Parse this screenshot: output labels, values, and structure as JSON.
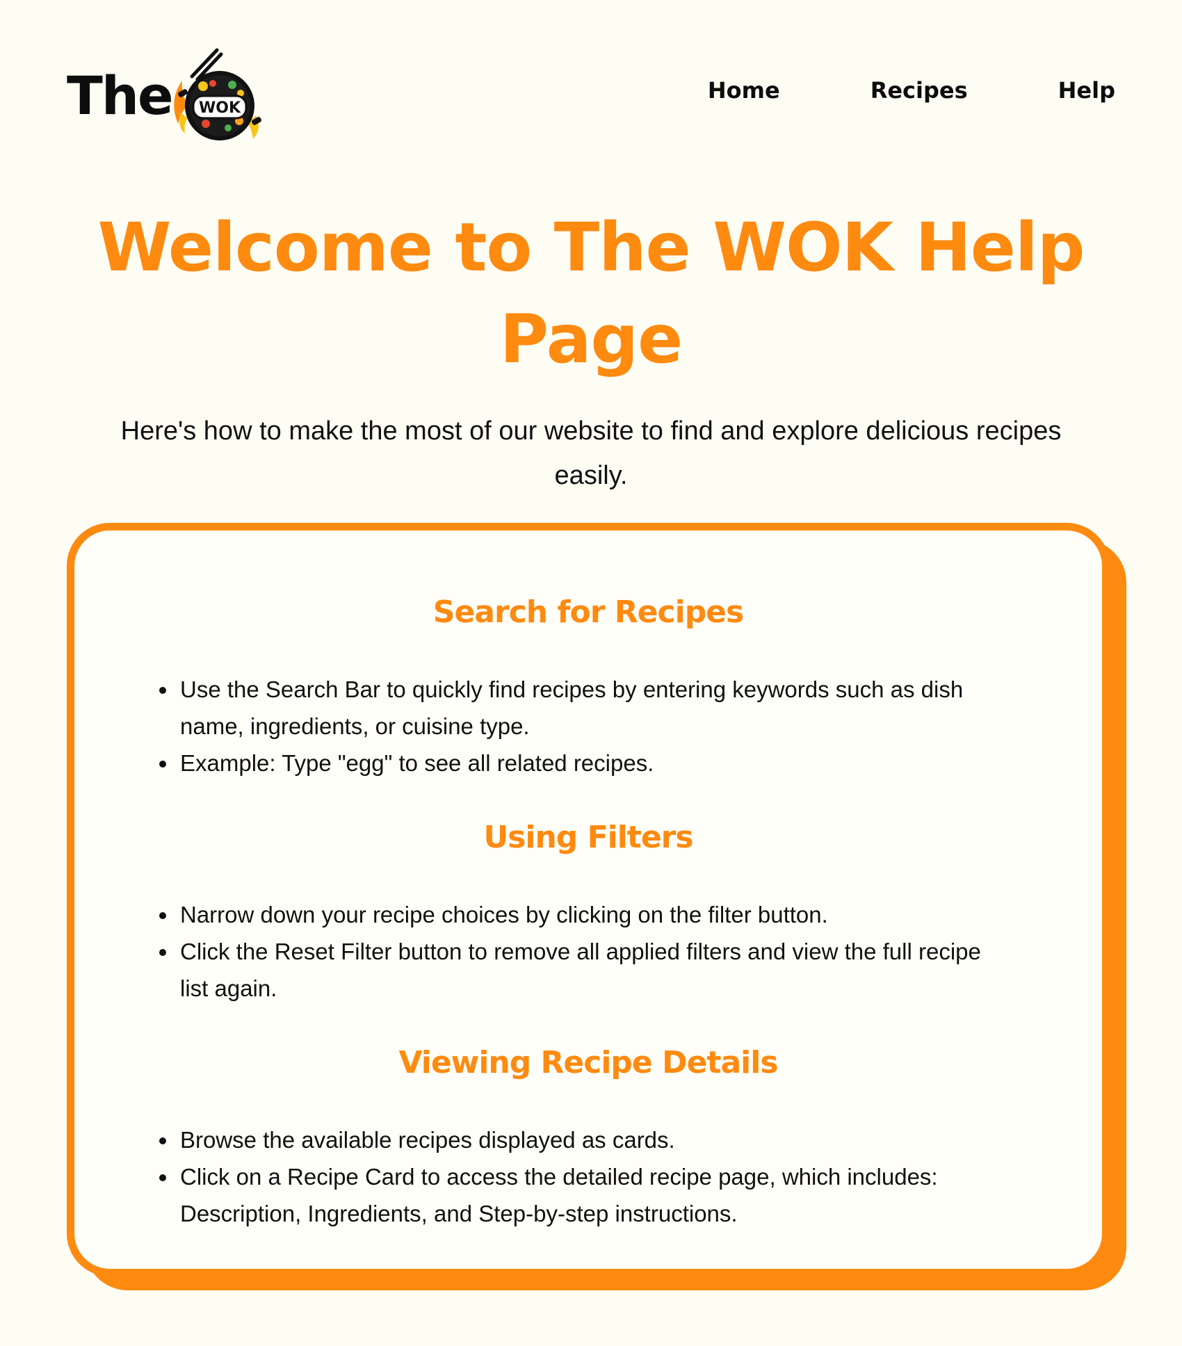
{
  "header": {
    "logo_text": "The",
    "logo_badge_text": "WOK",
    "nav": [
      {
        "label": "Home"
      },
      {
        "label": "Recipes"
      },
      {
        "label": "Help"
      }
    ]
  },
  "hero": {
    "title_line1": "Welcome to The WOK Help",
    "title_line2": "Page",
    "intro_line1": "Here's how to make the most of our website to find and explore delicious recipes",
    "intro_line2": "easily."
  },
  "sections": [
    {
      "heading": "Search for Recipes",
      "bullets": [
        {
          "line1": "Use the Search Bar to quickly find recipes by entering keywords such as dish",
          "line2": "name, ingredients, or cuisine type."
        },
        {
          "line1": "Example: Type \"egg\" to see all related recipes.",
          "line2": ""
        }
      ]
    },
    {
      "heading": "Using Filters",
      "bullets": [
        {
          "line1": "Narrow down your recipe choices by clicking on the filter button.",
          "line2": ""
        },
        {
          "line1": "Click the Reset Filter button to remove all applied filters and view the full recipe",
          "line2": "list again."
        }
      ]
    },
    {
      "heading": "Viewing Recipe Details",
      "bullets": [
        {
          "line1": "Browse the available recipes displayed as cards.",
          "line2": ""
        },
        {
          "line1": "Click on a Recipe Card to access the detailed recipe page, which includes:",
          "line2": "Description, Ingredients, and Step-by-step instructions."
        }
      ]
    }
  ],
  "colors": {
    "background": "#fefdf4",
    "accent": "#fe8a0f",
    "text": "#111111"
  }
}
